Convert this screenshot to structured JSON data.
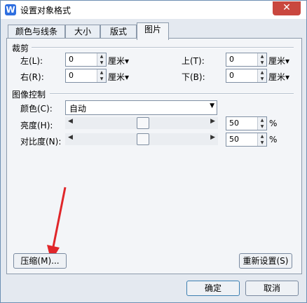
{
  "window": {
    "title": "设置对象格式",
    "app_icon": "W"
  },
  "tabs": [
    {
      "label": "颜色与线条"
    },
    {
      "label": "大小"
    },
    {
      "label": "版式"
    },
    {
      "label": "图片"
    }
  ],
  "crop": {
    "group_label": "裁剪",
    "left": {
      "label": "左(L):",
      "value": "0",
      "unit": "厘米▾"
    },
    "right": {
      "label": "右(R):",
      "value": "0",
      "unit": "厘米▾"
    },
    "top": {
      "label": "上(T):",
      "value": "0",
      "unit": "厘米▾"
    },
    "bottom": {
      "label": "下(B):",
      "value": "0",
      "unit": "厘米▾"
    }
  },
  "image_control": {
    "group_label": "图像控制",
    "color_label": "颜色(C):",
    "color_value": "自动",
    "brightness_label": "亮度(H):",
    "brightness_value": "50",
    "contrast_label": "对比度(N):",
    "contrast_value": "50",
    "percent": "%"
  },
  "buttons": {
    "compress": "压缩(M)...",
    "reset": "重新设置(S)",
    "ok": "确定",
    "cancel": "取消"
  },
  "colors": {
    "annotation_arrow": "#e0262a",
    "title_close": "#c9473f"
  }
}
